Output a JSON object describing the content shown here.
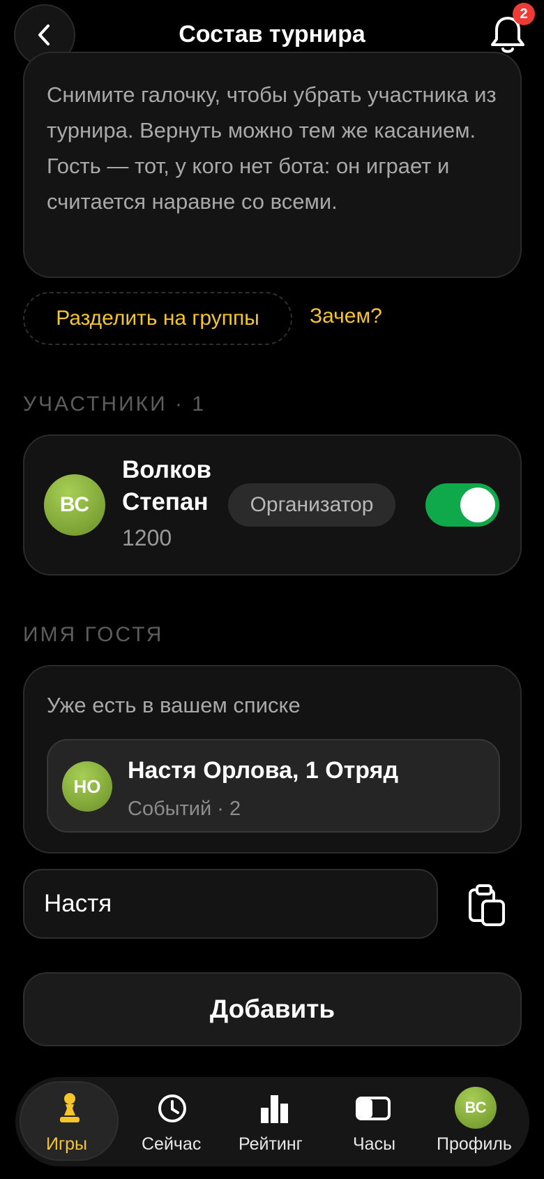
{
  "header": {
    "title": "Состав турнира",
    "notification_count": "2"
  },
  "info": {
    "text": "Снимите галочку, чтобы убрать участника из турнира. Вернуть можно тем же касанием. Гость — тот, у кого нет бота: он играет и считается наравне со всеми."
  },
  "actions": {
    "split_groups": "Разделить на группы",
    "why": "Зачем?"
  },
  "participants": {
    "label": "УЧАСТНИКИ · 1",
    "items": [
      {
        "initials": "ВС",
        "name_line1": "Волков",
        "name_line2": "Степан",
        "rating": "1200",
        "role": "Организатор",
        "included": true
      }
    ]
  },
  "guest": {
    "label": "ИМЯ ГОСТЯ",
    "hint": "Уже есть в вашем списке",
    "suggestion": {
      "initials": "НО",
      "name": "Настя Орлова, 1 Отряд",
      "meta": "Событий · 2"
    },
    "input_value": "Настя",
    "add_label": "Добавить"
  },
  "tabs": [
    {
      "label": "Игры",
      "icon": "pawn-icon",
      "active": true
    },
    {
      "label": "Сейчас",
      "icon": "clock-icon",
      "active": false
    },
    {
      "label": "Рейтинг",
      "icon": "bar-chart-icon",
      "active": false
    },
    {
      "label": "Часы",
      "icon": "chess-clock-icon",
      "active": false
    },
    {
      "label": "Профиль",
      "icon": "avatar",
      "initials": "ВС",
      "active": false
    }
  ],
  "colors": {
    "accent": "#f6c52a",
    "toggle_on": "#0fa84b",
    "badge": "#ef3b36",
    "avatar": "#86ac3c"
  }
}
